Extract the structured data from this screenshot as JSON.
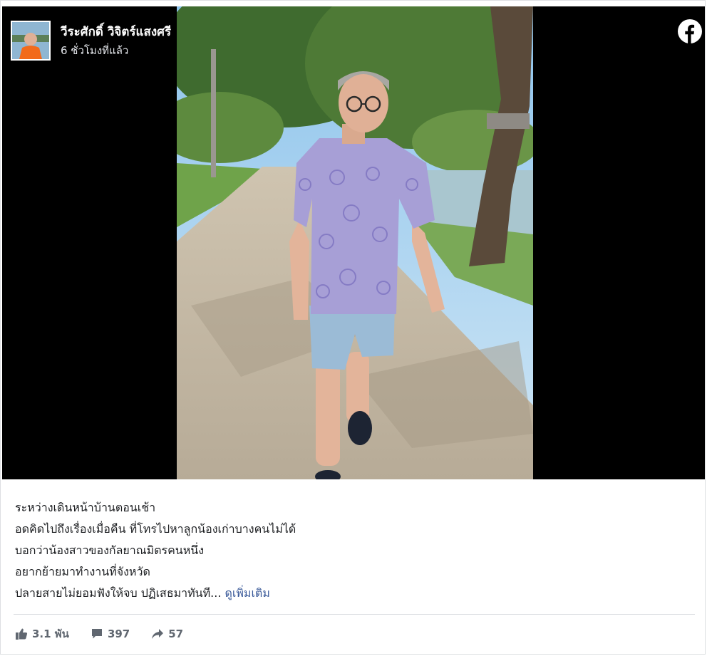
{
  "post": {
    "author": "วีระศักดิ์ วิจิตร์แสงศรี",
    "time": "6 ชั่วโมงที่แล้ว",
    "caption_lines": [
      "ระหว่างเดินหน้าบ้านตอนเช้า",
      "อดคิดไปถึงเรื่องเมื่อคืน ที่โทรไปหาลูกน้องเก่าบางคนไม่ได้",
      "บอกว่าน้องสาวของกัลยาณมิตรคนหนึ่ง",
      "อยากย้ายมาทำงานที่จังหวัด",
      "ปลายสายไม่ยอมฟังให้จบ ปฏิเสธมาทันที..."
    ],
    "see_more": "ดูเพิ่มเติม"
  },
  "stats": {
    "likes": "3.1 พัน",
    "comments": "397",
    "shares": "57"
  },
  "icons": {
    "brand": "facebook-icon",
    "like": "thumbs-up-icon",
    "comment": "comment-icon",
    "share": "share-arrow-icon"
  },
  "colors": {
    "media_background": "#000000",
    "link": "#385898",
    "stat_text": "#606770",
    "caption_text": "#1c1e21"
  }
}
